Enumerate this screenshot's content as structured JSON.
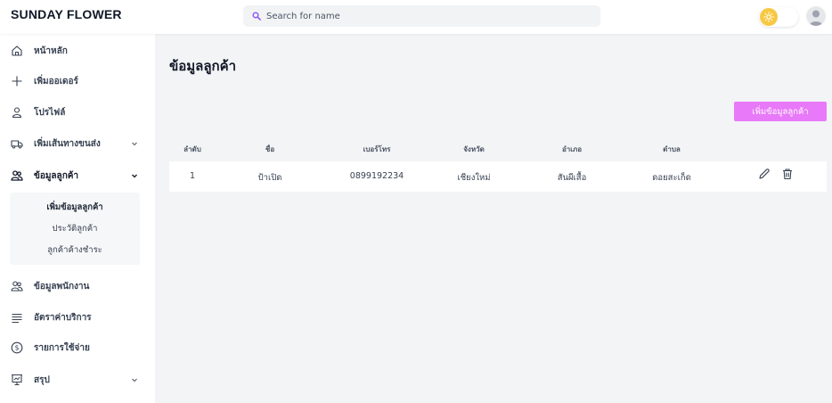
{
  "app": {
    "brand": "SUNDAY FLOWER"
  },
  "search": {
    "placeholder": "Search for name",
    "icon": "search-icon"
  },
  "header": {
    "theme_icon": "sun-icon",
    "avatar_icon": "user-icon",
    "accent": "#f7c843"
  },
  "sidebar": {
    "items": [
      {
        "label": "หน้าหลัก",
        "icon": "home-icon"
      },
      {
        "label": "เพิ่มออเดอร์",
        "icon": "plus-icon"
      },
      {
        "label": "โปรไฟล์",
        "icon": "user-icon"
      },
      {
        "label": "เพิ่มเส้นทางขนส่ง",
        "icon": "truck-icon",
        "expandable": true
      },
      {
        "label": "ข้อมูลลูกค้า",
        "icon": "users-icon",
        "expandable": true,
        "active": true
      },
      {
        "label": "ข้อมูลพนักงาน",
        "icon": "users-icon"
      },
      {
        "label": "อัตราค่าบริการ",
        "icon": "list-icon"
      },
      {
        "label": "รายการใช้จ่าย",
        "icon": "dollar-icon"
      },
      {
        "label": "สรุป",
        "icon": "presentation-icon",
        "expandable": true
      }
    ],
    "submenu": [
      {
        "label": "เพิ่มข้อมูลลูกค้า"
      },
      {
        "label": "ประวัติลูกค้า"
      },
      {
        "label": "ลูกค้าค้างชำระ"
      }
    ]
  },
  "main": {
    "title": "ข้อมูลลูกค้า",
    "add_button": "เพิ่มข้อมูลลูกค้า",
    "add_button_color": "#e879f9",
    "columns": [
      "ลำดับ",
      "ชื่อ",
      "เบอร์โทร",
      "จังหวัด",
      "อำเภอ",
      "ตำบล"
    ],
    "rows": [
      [
        "1",
        "ป้าเปิด",
        "0899192234",
        "เชียงใหม่",
        "สันผีเสื้อ",
        "ดอยสะเก็ด"
      ]
    ],
    "row_actions": [
      "edit-icon",
      "trash-icon"
    ]
  }
}
